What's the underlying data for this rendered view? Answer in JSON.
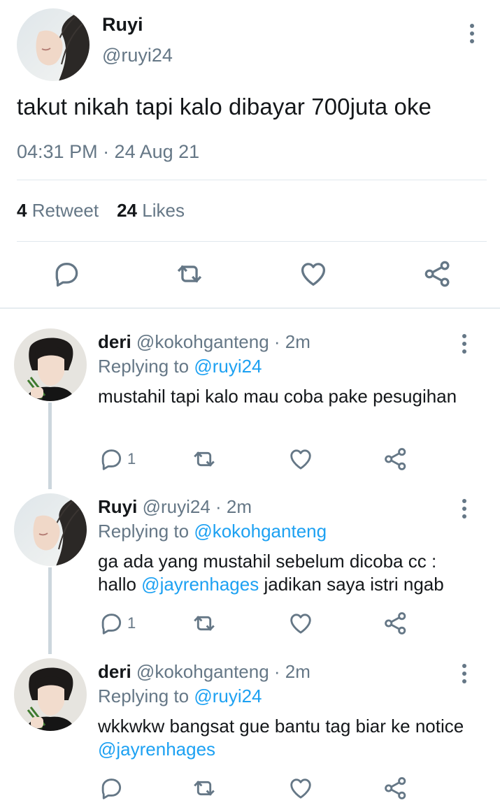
{
  "main_tweet": {
    "name": "Ruyi",
    "handle": "@ruyi24",
    "text": "takut nikah tapi kalo dibayar 700juta oke",
    "timestamp": "04:31 PM · 24 Aug 21",
    "retweet_count": "4",
    "retweet_label": "Retweet",
    "like_count": "24",
    "like_label": "Likes"
  },
  "replies": [
    {
      "name": "deri",
      "meta": "@kokohganteng · 2m",
      "replying_prefix": "Replying to",
      "replying_to": "@ruyi24",
      "text_1": "mustahil tapi kalo mau coba pake pesugihan",
      "reply_count": "1"
    },
    {
      "name": "Ruyi",
      "meta": "@ruyi24 · 2m",
      "replying_prefix": "Replying to",
      "replying_to": "@kokohganteng",
      "text_1": "ga ada yang mustahil sebelum dicoba cc : hallo",
      "mention": "@jayrenhages",
      "text_2": "jadikan saya istri ngab",
      "reply_count": "1"
    },
    {
      "name": "deri",
      "meta": "@kokohganteng · 2m",
      "replying_prefix": "Replying to",
      "replying_to": "@ruyi24",
      "text_1": "wkkwkw bangsat gue bantu tag biar ke notice",
      "mention": "@jayrenhages",
      "reply_count": ""
    }
  ],
  "icons": {
    "reply": "speech-bubble-icon",
    "retweet": "retweet-icon",
    "like": "heart-icon",
    "share": "share-icon",
    "more": "kebab-menu-icon"
  },
  "colors": {
    "accent": "#1da1f2",
    "muted": "#657786",
    "text": "#14171a",
    "divider": "#e1e8ed",
    "thread_line": "#ccd6dd"
  }
}
